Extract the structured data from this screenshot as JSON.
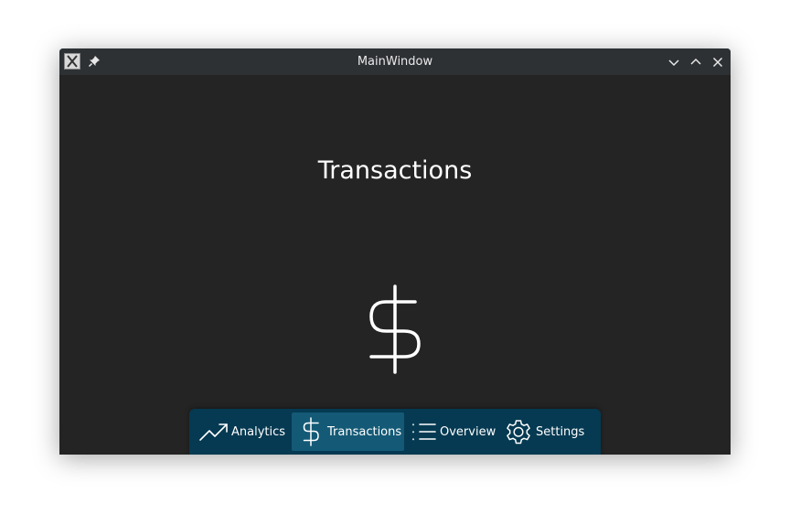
{
  "window": {
    "title": "MainWindow"
  },
  "page": {
    "heading": "Transactions",
    "main_icon": "dollar-icon"
  },
  "navbar": {
    "active": "Transactions",
    "items": [
      {
        "label": "Analytics",
        "icon": "trending-up-icon"
      },
      {
        "label": "Transactions",
        "icon": "dollar-icon"
      },
      {
        "label": "Overview",
        "icon": "list-icon"
      },
      {
        "label": "Settings",
        "icon": "gear-icon"
      }
    ]
  },
  "colors": {
    "titlebar": "#2e3134",
    "content_bg": "#242424",
    "navbar_bg": "#053a52",
    "nav_active_bg": "#145a76",
    "text": "#ffffff"
  }
}
